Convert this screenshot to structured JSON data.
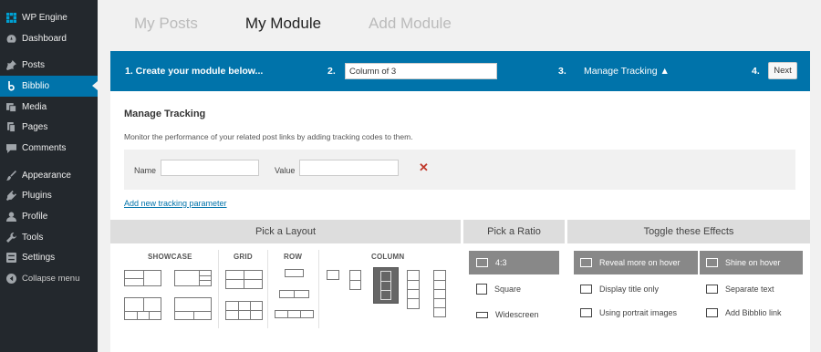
{
  "sidebar": {
    "items": [
      {
        "label": "WP Engine",
        "icon": "wp-engine-icon"
      },
      {
        "label": "Dashboard",
        "icon": "dashboard-icon"
      },
      {
        "label": "Posts",
        "icon": "pin-icon"
      },
      {
        "label": "Bibblio",
        "icon": "bibblio-icon"
      },
      {
        "label": "Media",
        "icon": "media-icon"
      },
      {
        "label": "Pages",
        "icon": "pages-icon"
      },
      {
        "label": "Comments",
        "icon": "comments-icon"
      },
      {
        "label": "Appearance",
        "icon": "brush-icon"
      },
      {
        "label": "Plugins",
        "icon": "plugin-icon"
      },
      {
        "label": "Profile",
        "icon": "user-icon"
      },
      {
        "label": "Tools",
        "icon": "wrench-icon"
      },
      {
        "label": "Settings",
        "icon": "settings-icon"
      },
      {
        "label": "Collapse menu",
        "icon": "collapse-icon"
      }
    ]
  },
  "tabs": [
    {
      "label": "My Posts"
    },
    {
      "label": "My Module"
    },
    {
      "label": "Add Module"
    }
  ],
  "steps": {
    "step1": "1. Create your module below...",
    "num2": "2.",
    "module_name": "Column of 3",
    "num3": "3.",
    "tracking": "Manage Tracking ▲",
    "num4": "4.",
    "next": "Next"
  },
  "tracking": {
    "title": "Manage Tracking",
    "description": "Monitor the performance of your related post links by adding tracking codes to them.",
    "name_label": "Name",
    "value_label": "Value",
    "remove": "✕",
    "add_link": "Add new tracking parameter"
  },
  "layout": {
    "title": "Pick a Layout",
    "groups": [
      "SHOWCASE",
      "GRID",
      "ROW",
      "COLUMN"
    ]
  },
  "ratio": {
    "title": "Pick a Ratio",
    "options": [
      "4:3",
      "Square",
      "Widescreen"
    ]
  },
  "effects": {
    "title": "Toggle these Effects",
    "options": [
      "Reveal more on hover",
      "Shine on hover",
      "Display title only",
      "Separate text",
      "Using portrait images",
      "Add Bibblio link"
    ]
  },
  "colors": {
    "accent": "#0073aa",
    "sidebar": "#23282d",
    "remove": "#c0392b"
  }
}
